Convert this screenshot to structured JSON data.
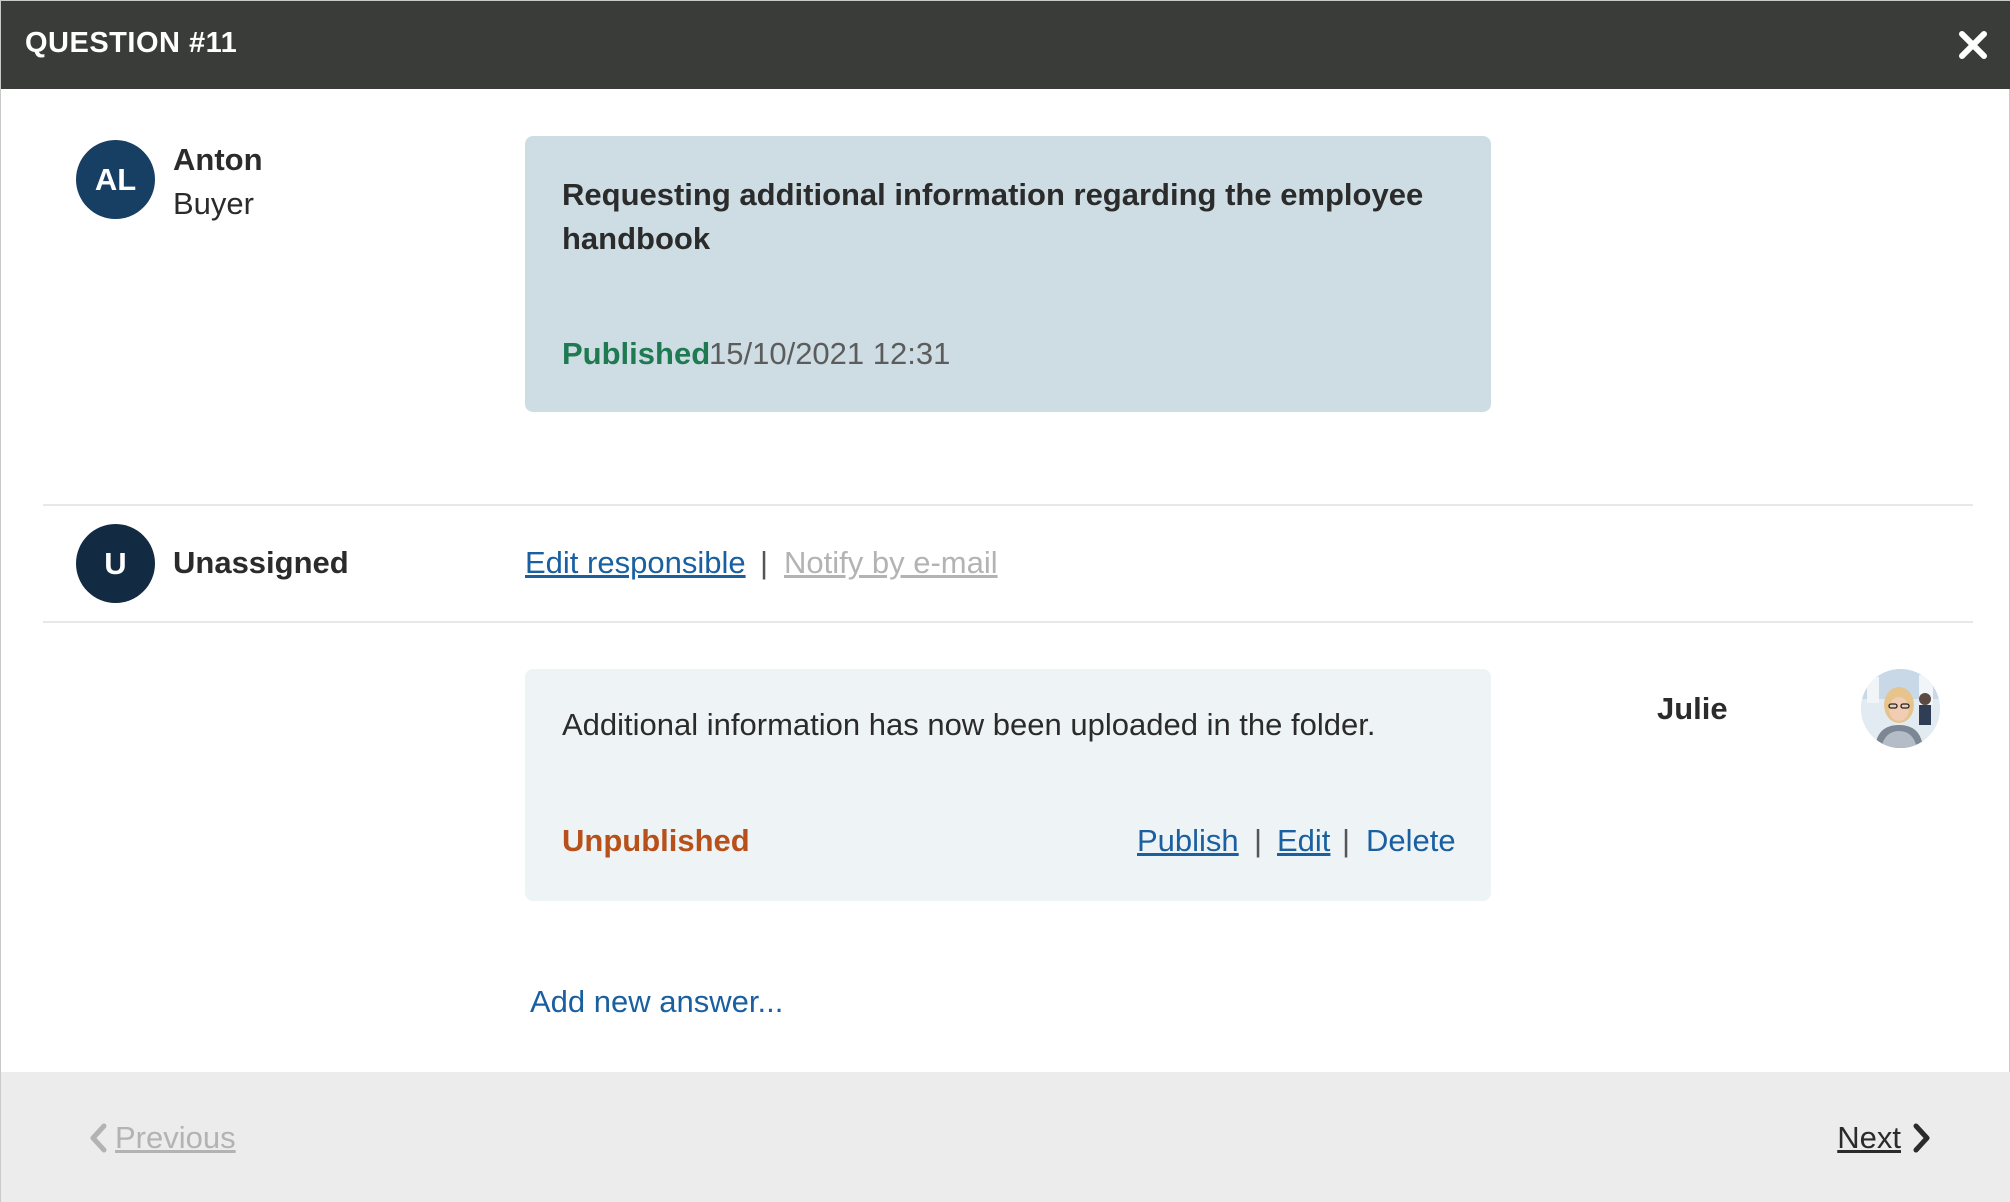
{
  "header": {
    "title": "QUESTION #11"
  },
  "asker": {
    "initials": "AL",
    "name": "Anton",
    "role": "Buyer"
  },
  "question": {
    "text": "Requesting additional information regarding the employee handbook",
    "status": "Published",
    "date": "15/10/2021 12:31"
  },
  "responsible": {
    "initials": "U",
    "name": "Unassigned",
    "edit_label": "Edit responsible",
    "separator": "|",
    "notify_label": "Notify by e-mail"
  },
  "answer": {
    "text": "Additional information has now been uploaded in the folder.",
    "status": "Unpublished",
    "publish_label": "Publish",
    "edit_label": "Edit",
    "delete_label": "Delete",
    "separator": "|",
    "author_name": "Julie"
  },
  "add_answer_label": "Add new answer...",
  "footer": {
    "previous_label": "Previous",
    "next_label": "Next"
  },
  "colors": {
    "header_bg": "#3a3c39",
    "avatar_bg": "#173e63",
    "published": "#1f7a52",
    "unpublished": "#b8501a",
    "link": "#1a60a0",
    "question_card_bg": "#cddde3",
    "answer_card_bg": "#eef3f6"
  }
}
